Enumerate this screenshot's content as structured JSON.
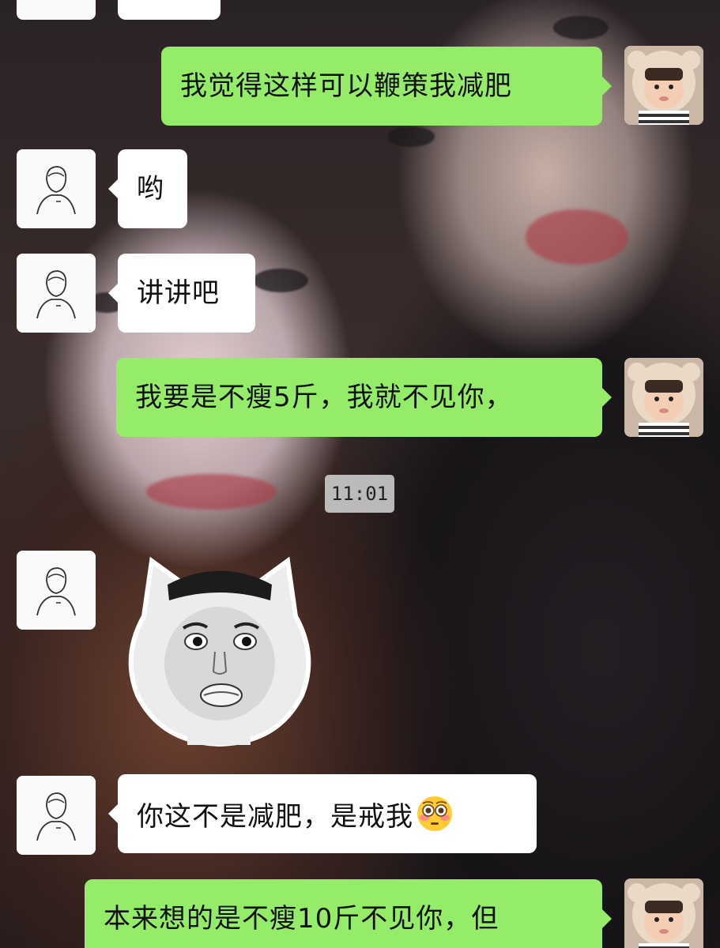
{
  "chat": {
    "messages": [
      {
        "sender": "me",
        "text": "我觉得这样可以鞭策我减肥"
      },
      {
        "sender": "them",
        "text": "哟"
      },
      {
        "sender": "them",
        "text": "讲讲吧"
      },
      {
        "sender": "me",
        "text": "我要是不瘦5斤，我就不见你，"
      },
      {
        "sender": "them",
        "sticker": "cat-face-meme-sticker"
      },
      {
        "sender": "them",
        "text": "你这不是减肥，是戒我",
        "emoji": "flushed-face-emoji"
      },
      {
        "sender": "me",
        "text": "本来想的是不瘦10斤不见你，但"
      }
    ],
    "timestamp": "11:01"
  },
  "colors": {
    "my_bubble": "#95ec69",
    "their_bubble": "#ffffff",
    "timestamp_badge": "#dcdcdc"
  },
  "icons": {
    "their_avatar": "sketch-person-avatar",
    "my_avatar": "baby-bear-hat-avatar"
  }
}
